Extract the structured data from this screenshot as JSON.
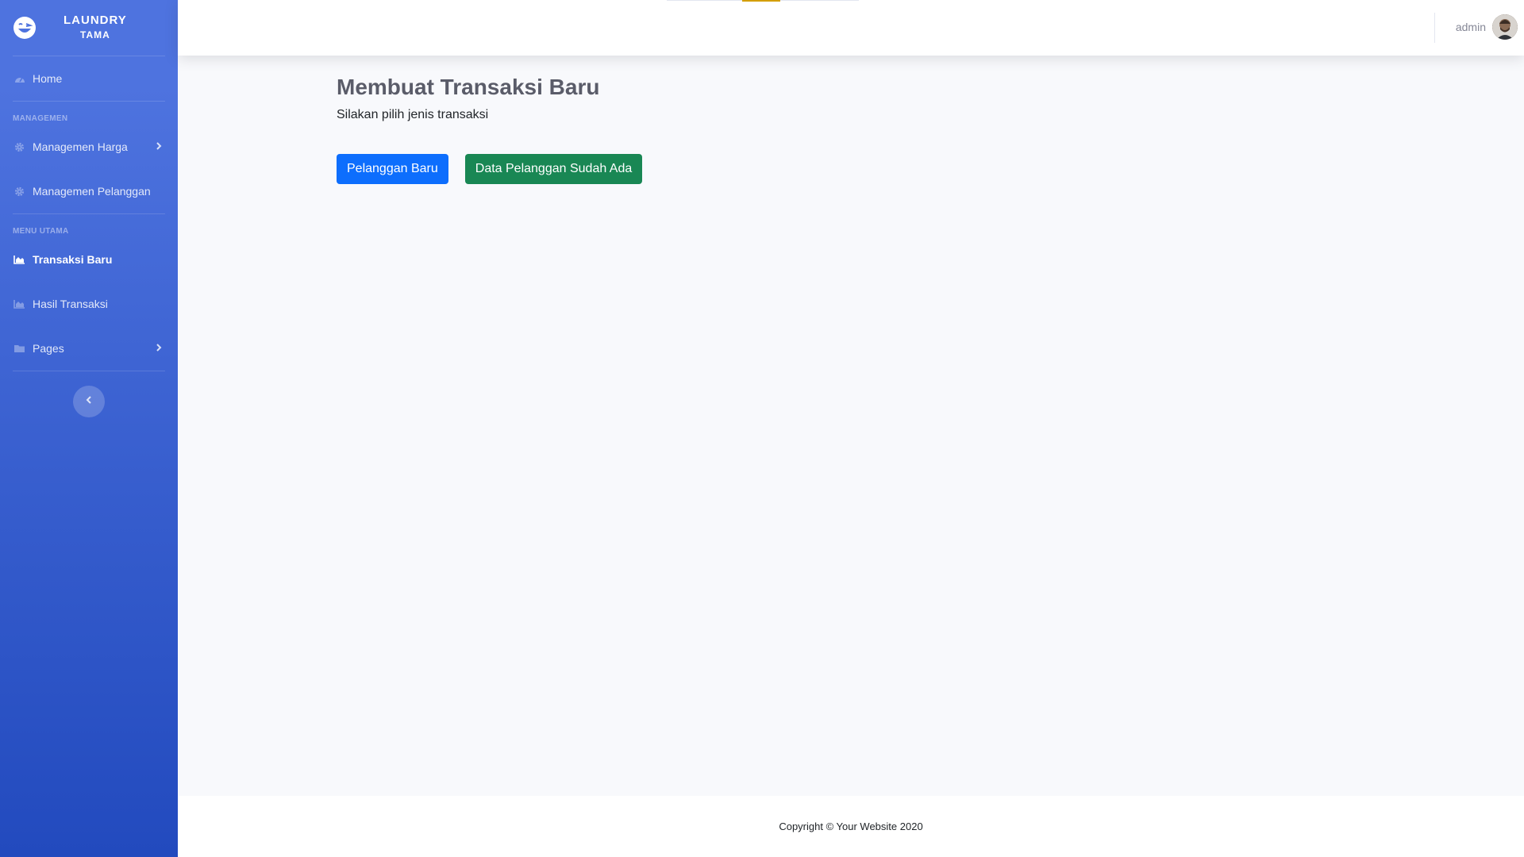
{
  "brand": {
    "line1": "LAUNDRY",
    "line2": "TAMA",
    "logo_icon": "laugh-wink-icon"
  },
  "sidebar": {
    "home": {
      "label": "Home",
      "icon": "tachometer-icon"
    },
    "heading_managemen": "MANAGEMEN",
    "managemen_harga": {
      "label": "Managemen Harga",
      "icon": "cog-icon"
    },
    "managemen_pelanggan": {
      "label": "Managemen Pelanggan",
      "icon": "cog-icon"
    },
    "heading_menu_utama": "MENU UTAMA",
    "transaksi_baru": {
      "label": "Transaksi Baru",
      "icon": "chart-area-icon",
      "active": true
    },
    "hasil_transaksi": {
      "label": "Hasil Transaksi",
      "icon": "chart-area-icon"
    },
    "pages": {
      "label": "Pages",
      "icon": "folder-icon"
    }
  },
  "topbar": {
    "username": "admin"
  },
  "main": {
    "title": "Membuat Transaksi Baru",
    "subtitle": "Silakan pilih jenis transaksi",
    "btn_new": "Pelanggan Baru",
    "btn_existing": "Data Pelanggan Sudah Ada"
  },
  "footer": {
    "text": "Copyright © Your Website 2020"
  },
  "colors": {
    "sidebar_top": "#4e73df",
    "sidebar_bottom": "#224abe",
    "primary": "#0d6efd",
    "success": "#198754"
  }
}
